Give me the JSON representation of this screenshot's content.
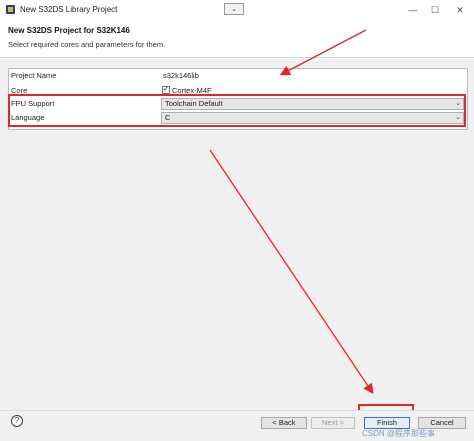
{
  "window": {
    "title": "New S32DS Library Project",
    "minimize_glyph": "—",
    "maximize_glyph": "☐",
    "close_glyph": "✕",
    "chevron_glyph": "⌄"
  },
  "header": {
    "title": "New S32DS Project for S32K146",
    "subtitle": "Select required cores and parameters for them."
  },
  "form": {
    "project_name_label": "Project Name",
    "project_name_value": "s32k146lib",
    "core_label": "Core",
    "core_checked": true,
    "core_check_glyph": "✓",
    "core_value": "Cortex-M4F",
    "fpu_label": "FPU Support",
    "fpu_value": "Toolchain Default",
    "language_label": "Language",
    "language_value": "C",
    "dropdown_glyph": "⌄"
  },
  "footer": {
    "help_glyph": "?",
    "back_label": "< Back",
    "next_label": "Next >",
    "finish_label": "Finish",
    "cancel_label": "Cancel"
  },
  "watermark": "CSDN @程序那些事",
  "colors": {
    "annotation_red": "#e02828",
    "dialog_bg": "#f0f0f0",
    "window_bg": "#ffffff"
  }
}
